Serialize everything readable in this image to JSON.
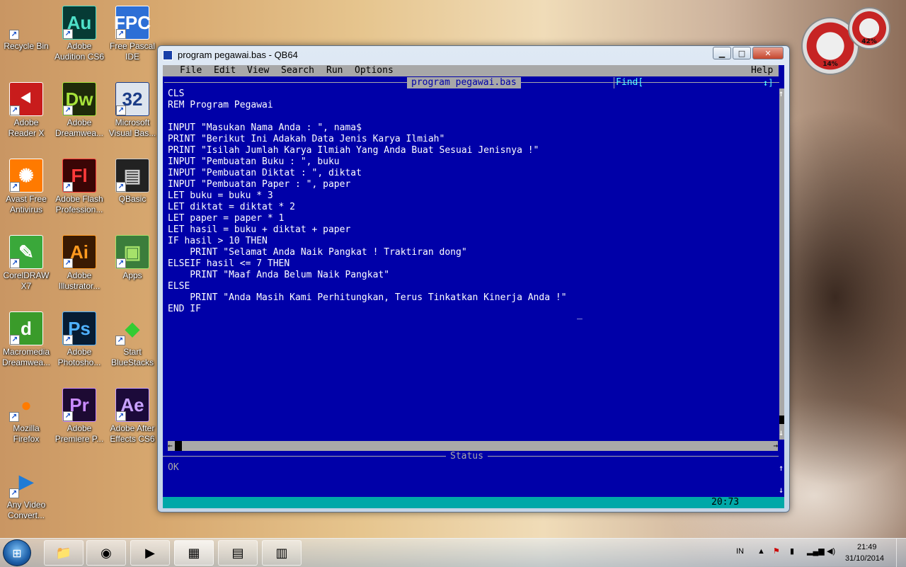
{
  "desktop": {
    "icons": [
      {
        "label": "Recycle Bin",
        "icon": "recycle-bin-icon",
        "glyph": "",
        "bg": "transparent",
        "fg": "#ccc"
      },
      {
        "label": "Adobe Audition CS6",
        "icon": "adobe-audition-icon",
        "glyph": "Au",
        "bg": "#063b35",
        "fg": "#4fe0c9"
      },
      {
        "label": "Free Pascal IDE",
        "icon": "free-pascal-icon",
        "glyph": "FPC",
        "bg": "#2d6fd6",
        "fg": "#ffffff"
      },
      {
        "label": "Adobe Reader X",
        "icon": "adobe-reader-icon",
        "glyph": "⯇",
        "bg": "#c81c1c",
        "fg": "#ffffff"
      },
      {
        "label": "Adobe Dreamwea...",
        "icon": "adobe-dreamweaver-icon",
        "glyph": "Dw",
        "bg": "#1f2b0a",
        "fg": "#a6e23a"
      },
      {
        "label": "Microsoft Visual Bas...",
        "icon": "visual-basic-icon",
        "glyph": "32",
        "bg": "#dde4ee",
        "fg": "#1b3c87"
      },
      {
        "label": "Avast Free Antivirus",
        "icon": "avast-icon",
        "glyph": "✺",
        "bg": "#ff7a00",
        "fg": "#ffffff"
      },
      {
        "label": "Adobe Flash Profession...",
        "icon": "adobe-flash-icon",
        "glyph": "Fl",
        "bg": "#3a0505",
        "fg": "#ff3b3b"
      },
      {
        "label": "QBasic",
        "icon": "qbasic-icon",
        "glyph": "▤",
        "bg": "#222222",
        "fg": "#cccccc"
      },
      {
        "label": "CorelDRAW X7",
        "icon": "coreldraw-icon",
        "glyph": "✎",
        "bg": "#3aa83a",
        "fg": "#ffffff"
      },
      {
        "label": "Adobe Illustrator...",
        "icon": "adobe-illustrator-icon",
        "glyph": "Ai",
        "bg": "#3a1a02",
        "fg": "#ff9a1f"
      },
      {
        "label": "Apps",
        "icon": "apps-icon",
        "glyph": "▣",
        "bg": "#3b7d3b",
        "fg": "#a6e26a"
      },
      {
        "label": "Macromedia Dreamwea...",
        "icon": "macromedia-dreamweaver-icon",
        "glyph": "d",
        "bg": "#3a9b2a",
        "fg": "#ffffff"
      },
      {
        "label": "Adobe Photosho...",
        "icon": "adobe-photoshop-icon",
        "glyph": "Ps",
        "bg": "#061c33",
        "fg": "#4fb2ff"
      },
      {
        "label": "Start BlueStacks",
        "icon": "bluestacks-icon",
        "glyph": "◆",
        "bg": "transparent",
        "fg": "#33cc33"
      },
      {
        "label": "Mozilla Firefox",
        "icon": "firefox-icon",
        "glyph": "●",
        "bg": "transparent",
        "fg": "#ff7b00"
      },
      {
        "label": "Adobe Premiere P...",
        "icon": "adobe-premiere-icon",
        "glyph": "Pr",
        "bg": "#1d0a33",
        "fg": "#c98bff"
      },
      {
        "label": "Adobe After Effects CS6",
        "icon": "adobe-after-effects-icon",
        "glyph": "Ae",
        "bg": "#1c0a3a",
        "fg": "#c9a2ff"
      },
      {
        "label": "Any Video Convert...",
        "icon": "any-video-converter-icon",
        "glyph": "▶",
        "bg": "transparent",
        "fg": "#1f7bd6"
      }
    ]
  },
  "gadget": {
    "cpu": "14%",
    "memory": "42%"
  },
  "window": {
    "title": "program pegawai.bas - QB64",
    "minimize": "▁",
    "maximize": "□",
    "close": "✕"
  },
  "qb64": {
    "menu": [
      "File",
      "Edit",
      "View",
      "Search",
      "Run",
      "Options"
    ],
    "help": "Help",
    "file_title": "program pegawai.bas",
    "find_label": "Find[",
    "find_arrows": "↕]",
    "code": "CLS\nREM Program Pegawai\n\nINPUT \"Masukan Nama Anda : \", nama$\nPRINT \"Berikut Ini Adakah Data Jenis Karya Ilmiah\"\nPRINT \"Isilah Jumlah Karya Ilmiah Yang Anda Buat Sesuai Jenisnya !\"\nINPUT \"Pembuatan Buku : \", buku\nINPUT \"Pembuatan Diktat : \", diktat\nINPUT \"Pembuatan Paper : \", paper\nLET buku = buku * 3\nLET diktat = diktat * 2\nLET paper = paper * 1\nLET hasil = buku + diktat + paper\nIF hasil > 10 THEN\n    PRINT \"Selamat Anda Naik Pangkat ! Traktiran dong\"\nELSEIF hasil <= 7 THEN\n    PRINT \"Maaf Anda Belum Naik Pangkat\"\nELSE\n    PRINT \"Anda Masih Kami Perhitungkan, Terus Tinkatkan Kinerja Anda !\"\nEND IF",
    "cursor": "_",
    "scroll_up": "↑",
    "scroll_down": "↓",
    "scroll_left": "←",
    "scroll_right": "→",
    "status_title": "Status",
    "status_text": "OK",
    "cursor_position": "20:73"
  },
  "taskbar": {
    "start": "⊞",
    "buttons": [
      {
        "icon": "file-explorer-icon",
        "glyph": "📁"
      },
      {
        "icon": "firefox-taskbar-icon",
        "glyph": "◉"
      },
      {
        "icon": "media-player-icon",
        "glyph": "▶"
      },
      {
        "icon": "qbasic-taskbar-icon",
        "glyph": "▦"
      },
      {
        "icon": "control-panel-icon",
        "glyph": "▤"
      },
      {
        "icon": "qb64-taskbar-icon",
        "glyph": "▥"
      }
    ],
    "language": "IN",
    "time": "21:49",
    "date": "31/10/2014"
  }
}
